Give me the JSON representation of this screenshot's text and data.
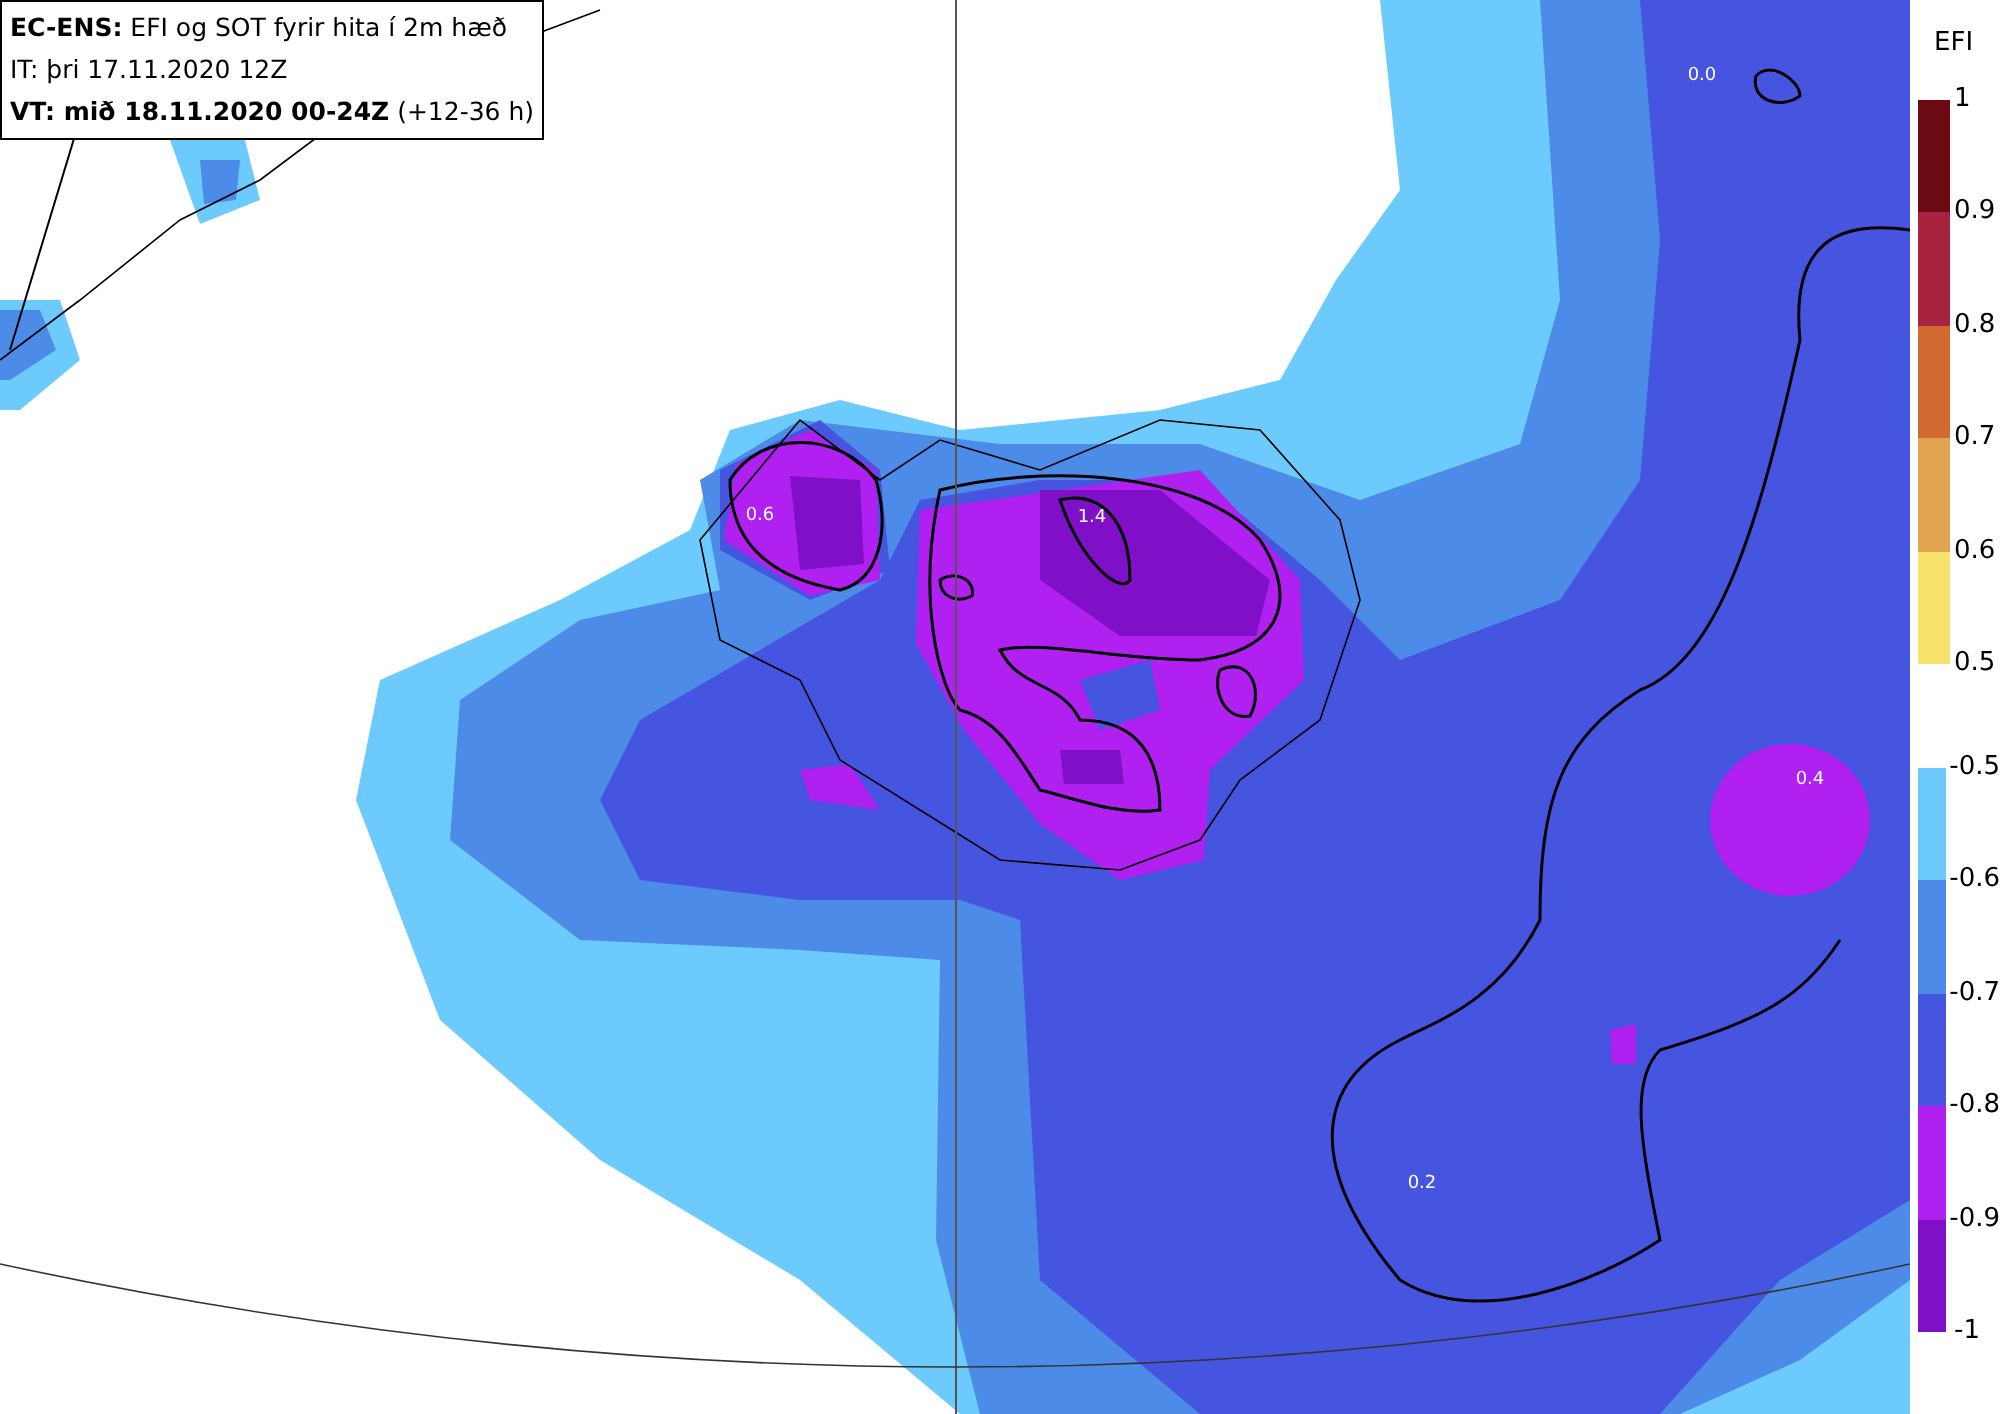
{
  "title_box": {
    "lines": [
      "**EC-ENS:** EFI og SOT fyrir hita í 2m hæð",
      "IT: þri 17.11.2020 12Z",
      "**VT: mið 18.11.2020 00-24Z** (+12-36 h)"
    ]
  },
  "map": {
    "contour_labels": [
      "0.0",
      "0.6",
      "1.4",
      "0.4",
      "0.2"
    ]
  },
  "colorbar": {
    "title": "EFI",
    "warm": {
      "bands": [
        {
          "color": "#6b0a12"
        },
        {
          "color": "#a8233f"
        },
        {
          "color": "#d06a30"
        },
        {
          "color": "#e2a54f"
        },
        {
          "color": "#f7e26b"
        }
      ],
      "ticks": [
        "1",
        "0.9",
        "0.8",
        "0.7",
        "0.6",
        "0.5"
      ]
    },
    "cold": {
      "bands": [
        {
          "color": "#6ccbfc"
        },
        {
          "color": "#4c8ce8"
        },
        {
          "color": "#4655e0"
        },
        {
          "color": "#b020f0"
        },
        {
          "color": "#8010c8"
        }
      ],
      "ticks": [
        "-0.5",
        "-0.6",
        "-0.7",
        "-0.8",
        "-0.9",
        "-1"
      ]
    }
  }
}
